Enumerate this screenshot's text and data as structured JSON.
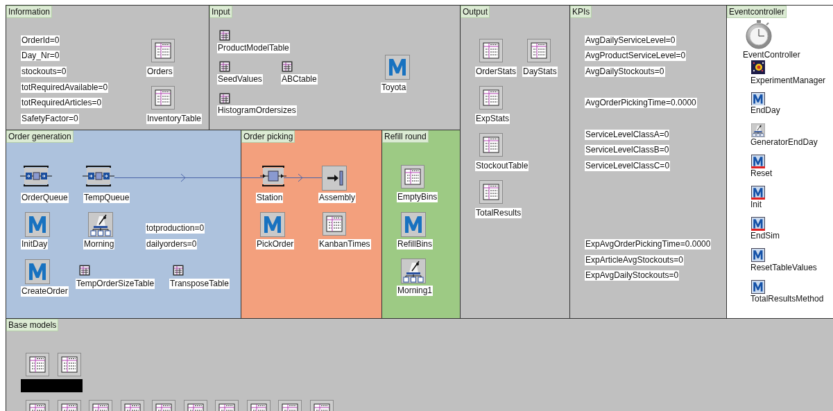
{
  "frames": [
    {
      "title": "Information",
      "color": "#c0c0c0",
      "objects": [
        {
          "kind": "variable",
          "label": "OrderId=0"
        },
        {
          "kind": "variable",
          "label": "Day_Nr=0"
        },
        {
          "kind": "variable",
          "label": "stockouts=0"
        },
        {
          "kind": "variable",
          "label": "totRequiredAvailable=0"
        },
        {
          "kind": "variable",
          "label": "totRequiredArticles=0"
        },
        {
          "kind": "variable",
          "label": "SafetyFactor=0"
        },
        {
          "kind": "table",
          "label": "Orders"
        },
        {
          "kind": "table",
          "label": "InventoryTable"
        }
      ]
    },
    {
      "title": "Input",
      "color": "#c0c0c0",
      "objects": [
        {
          "kind": "small-table",
          "label": "ProductModelTable"
        },
        {
          "kind": "small-table",
          "label": "SeedValues"
        },
        {
          "kind": "small-table",
          "label": "ABCtable"
        },
        {
          "kind": "small-table",
          "label": "HistogramOrdersizes"
        },
        {
          "kind": "method",
          "label": "Toyota"
        }
      ]
    },
    {
      "title": "Output",
      "color": "#c0c0c0",
      "objects": [
        {
          "kind": "table",
          "label": "OrderStats"
        },
        {
          "kind": "table",
          "label": "DayStats"
        },
        {
          "kind": "table",
          "label": "ExpStats"
        },
        {
          "kind": "table",
          "label": "StockoutTable"
        },
        {
          "kind": "table",
          "label": "TotalResults"
        }
      ]
    },
    {
      "title": "KPIs",
      "color": "#c0c0c0",
      "objects": [
        {
          "kind": "variable",
          "label": "AvgDailyServiceLevel=0"
        },
        {
          "kind": "variable",
          "label": "AvgProductServiceLevel=0"
        },
        {
          "kind": "variable",
          "label": "AvgDailyStockouts=0"
        },
        {
          "kind": "variable",
          "label": "AvgOrderPickingTime=0.0000"
        },
        {
          "kind": "variable",
          "label": "ServiceLevelClassA=0"
        },
        {
          "kind": "variable",
          "label": "ServiceLevelClassB=0"
        },
        {
          "kind": "variable",
          "label": "ServiceLevelClassC=0"
        },
        {
          "kind": "variable",
          "label": "ExpAvgOrderPickingTime=0.0000"
        },
        {
          "kind": "variable",
          "label": "ExpArticleAvgStockouts=0"
        },
        {
          "kind": "variable",
          "label": "ExpAvgDailyStockouts=0"
        }
      ]
    },
    {
      "title": "Eventcontroller",
      "color": "#ffffff",
      "objects": [
        {
          "kind": "stopwatch",
          "label": "EventController"
        },
        {
          "kind": "experiment",
          "label": "ExperimentManager"
        },
        {
          "kind": "method-small",
          "label": "EndDay"
        },
        {
          "kind": "generator-small",
          "label": "GeneratorEndDay"
        },
        {
          "kind": "method-special",
          "label": "Reset"
        },
        {
          "kind": "method-special",
          "label": "Init"
        },
        {
          "kind": "method-special",
          "label": "EndSim"
        },
        {
          "kind": "method-small",
          "label": "ResetTableValues"
        },
        {
          "kind": "method-small",
          "label": "TotalResultsMethod"
        }
      ]
    },
    {
      "title": "Order generation",
      "color": "#adc2dd",
      "objects": [
        {
          "kind": "queue",
          "label": "OrderQueue"
        },
        {
          "kind": "queue",
          "label": "TempQueue"
        },
        {
          "kind": "method",
          "label": "InitDay"
        },
        {
          "kind": "generator",
          "label": "Morning"
        },
        {
          "kind": "variable",
          "label": "totproduction=0"
        },
        {
          "kind": "variable",
          "label": "dailyorders=0"
        },
        {
          "kind": "method",
          "label": "CreateOrder"
        },
        {
          "kind": "small-table",
          "label": "TempOrderSizeTable"
        },
        {
          "kind": "small-table",
          "label": "TransposeTable"
        }
      ]
    },
    {
      "title": "Order picking",
      "color": "#f3a07d",
      "objects": [
        {
          "kind": "station",
          "label": "Station"
        },
        {
          "kind": "assembly",
          "label": "Assembly"
        },
        {
          "kind": "method",
          "label": "PickOrder"
        },
        {
          "kind": "table",
          "label": "KanbanTimes"
        }
      ]
    },
    {
      "title": "Refill round",
      "color": "#9dca84",
      "objects": [
        {
          "kind": "table",
          "label": "EmptyBins"
        },
        {
          "kind": "method",
          "label": "RefillBins"
        },
        {
          "kind": "generator",
          "label": "Morning1"
        }
      ]
    },
    {
      "title": "Base models",
      "color": "#c0c0c0",
      "objects": [
        {
          "kind": "table"
        },
        {
          "kind": "table"
        },
        {
          "kind": "redacted"
        },
        {
          "kind": "table"
        },
        {
          "kind": "table"
        },
        {
          "kind": "table"
        },
        {
          "kind": "table"
        },
        {
          "kind": "table"
        },
        {
          "kind": "table"
        },
        {
          "kind": "table"
        },
        {
          "kind": "table"
        },
        {
          "kind": "table"
        },
        {
          "kind": "table"
        }
      ]
    }
  ]
}
